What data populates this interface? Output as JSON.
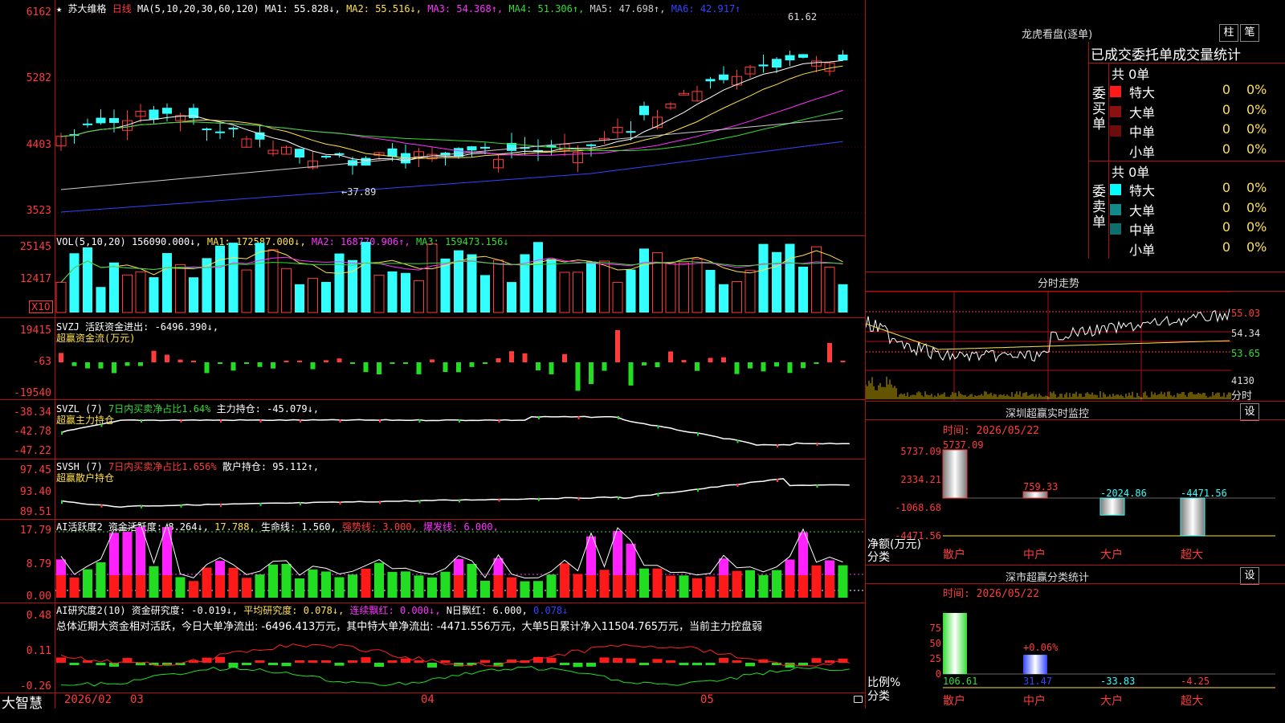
{
  "stock": {
    "star": "★",
    "name": "苏大维格",
    "period": "日线",
    "ma_label": "MA(5,10,20,30,60,120)",
    "ma": [
      {
        "text": "MA1: 55.828↓,",
        "color": "#ffffff"
      },
      {
        "text": "MA2: 55.516↓,",
        "color": "#ffe14a"
      },
      {
        "text": "MA3: 54.368↑,",
        "color": "#ff33ff"
      },
      {
        "text": "MA4: 51.306↑,",
        "color": "#33dd33"
      },
      {
        "text": "MA5: 47.698↑,",
        "color": "#cccccc"
      },
      {
        "text": "MA6: 42.917↑",
        "color": "#3344ff"
      }
    ],
    "y_ticks": [
      "6162",
      "5282",
      "4403",
      "3523"
    ],
    "high_marker": "61.62",
    "low_marker": "37.89"
  },
  "volume": {
    "header_label": "VOL(5,10,20)",
    "items": [
      {
        "text": "156090.000↓,",
        "color": "#ffffff"
      },
      {
        "text": "MA1: 172587.000↓,",
        "color": "#ffe14a"
      },
      {
        "text": "MA2: 168770.906↑,",
        "color": "#ff33ff"
      },
      {
        "text": "MA3: 159473.156↓",
        "color": "#33dd33"
      }
    ],
    "y_ticks": [
      "25145",
      "12417"
    ],
    "unit": "X10"
  },
  "svzj": {
    "line1": "SVZJ  活跃资金进出: -6496.390↓,",
    "line2": "超赢资金流(万元)",
    "y_ticks": [
      "19415",
      "-63",
      "-19540"
    ]
  },
  "svzl": {
    "prefix": "SVZL (7)",
    "ratio": "7日内买卖净占比1.64%",
    "hold": "主力持仓: -45.079↓,",
    "line2": "超赢主力持仓",
    "y_ticks": [
      "-38.34",
      "-42.78",
      "-47.22"
    ]
  },
  "svsh": {
    "prefix": "SVSH (7)",
    "ratio": "7日内买卖净占比1.656%",
    "hold": "散户持仓: 95.112↑,",
    "line2": "超赢散户持仓",
    "y_ticks": [
      "97.45",
      "93.40",
      "89.51"
    ]
  },
  "ai_active": {
    "items": [
      {
        "text": "AI活跃度2 资金活跃度: 8.264↓,",
        "color": "#ffffff"
      },
      {
        "text": "17.788,",
        "color": "#ffe14a"
      },
      {
        "text": "生命线: 1.560,",
        "color": "#ffffff"
      },
      {
        "text": "强势线: 3.000,",
        "color": "#ff3b3b"
      },
      {
        "text": "爆发线: 6.000,",
        "color": "#ff33ff"
      }
    ],
    "y_ticks": [
      "17.79",
      "8.79",
      "0.00"
    ]
  },
  "ai_research": {
    "items": [
      {
        "text": "AI研究度2(10) 资金研究度: -0.019↓,",
        "color": "#ffffff"
      },
      {
        "text": "平均研究度: 0.078↓,",
        "color": "#ffe14a"
      },
      {
        "text": "连续飘红: 0.000↓,",
        "color": "#ff33ff"
      },
      {
        "text": "N日飘红: 6.000,",
        "color": "#ffffff"
      },
      {
        "text": "0.078↓",
        "color": "#3344ff"
      }
    ],
    "summary": "总体近期大资金相对活跃，今日大单净流出: -6496.413万元，其中特大单净流出: -4471.556万元，大单5日累计净入11504.765万元，当前主力控盘弱",
    "y_ticks": [
      "0.48",
      "0.11",
      "-0.26"
    ]
  },
  "bottom": {
    "brand": "大智慧",
    "dates": [
      "2026/02",
      "03",
      "04",
      "05"
    ]
  },
  "right": {
    "dragon_title": "龙虎看盘(逐单)",
    "btn_bar": "柱",
    "btn_count": "笔",
    "order_header": "已成交委托单成交量统计",
    "buy_side": "委买单",
    "sell_side": "委卖单",
    "buy_total": "共 0单",
    "sell_total": "共 0单",
    "buy_rows": [
      {
        "label": "特大",
        "v1": "0",
        "v2": "0%",
        "color": "#ff1a1a"
      },
      {
        "label": "大单",
        "v1": "0",
        "v2": "0%",
        "color": "#8b1010"
      },
      {
        "label": "中单",
        "v1": "0",
        "v2": "0%",
        "color": "#6b0d0d"
      },
      {
        "label": "小单",
        "v1": "0",
        "v2": "0%",
        "color": "#000000"
      }
    ],
    "sell_rows": [
      {
        "label": "特大",
        "v1": "0",
        "v2": "0%",
        "color": "#00ffff"
      },
      {
        "label": "大单",
        "v1": "0",
        "v2": "0%",
        "color": "#138a8a"
      },
      {
        "label": "中单",
        "v1": "0",
        "v2": "0%",
        "color": "#0f6d6d"
      },
      {
        "label": "小单",
        "v1": "0",
        "v2": "0%",
        "color": "#000000"
      }
    ],
    "intraday_title": "分时走势",
    "intraday_ticks": [
      "55.03",
      "54.34",
      "53.65",
      "4130",
      "分时"
    ],
    "monitor_title": "深圳超赢实时监控",
    "monitor_set": "设",
    "monitor_date": "时间: 2026/05/22",
    "monitor_y": [
      "5737.09",
      "2334.21",
      "-1068.68",
      "-4471.56"
    ],
    "monitor_axis_title": "净额(万元)",
    "monitor_axis_sub": "分类",
    "monitor_values": [
      {
        "label": "散户",
        "value": "5737.09",
        "num": 5737.09,
        "color": "#ff3b3b"
      },
      {
        "label": "中户",
        "value": "759.33",
        "num": 759.33,
        "color": "#ff3b3b"
      },
      {
        "label": "大户",
        "value": "-2024.86",
        "num": -2024.86,
        "color": "#33ffff"
      },
      {
        "label": "超大",
        "value": "-4471.56",
        "num": -4471.56,
        "color": "#33ffff"
      }
    ],
    "class_title": "深市超赢分类统计",
    "class_set": "设",
    "class_date": "时间: 2026/05/22",
    "class_y": [
      "75",
      "50",
      "25",
      "0"
    ],
    "class_axis_title": "比例%",
    "class_axis_sub": "分类",
    "class_top_label": "+0.06%",
    "class_values": [
      {
        "label": "散户",
        "value": "106.61",
        "num": 106.61,
        "color": "#33dd33"
      },
      {
        "label": "中户",
        "value": "31.47",
        "num": 31.47,
        "color": "#3344ff"
      },
      {
        "label": "大户",
        "value": "-33.83",
        "num": -33.83,
        "color": "#33ffff"
      },
      {
        "label": "超大",
        "value": "-4.25",
        "num": -4.25,
        "color": "#ff3b3b"
      }
    ]
  },
  "colors": {
    "up": "#ff3b3b",
    "down": "#33ffff",
    "grid": "#b01010"
  }
}
